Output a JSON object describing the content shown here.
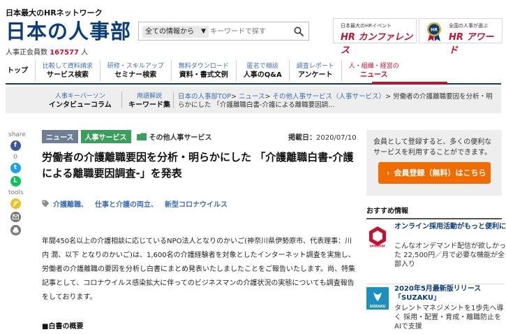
{
  "header": {
    "tagline": "日本最大のHRネットワーク",
    "logo": "日本の人事部",
    "member_label": "人事正会員数",
    "member_count": "167577",
    "member_unit": "人"
  },
  "search": {
    "scope": "全ての情報から",
    "placeholder": "キーワードで探す"
  },
  "banners": {
    "conference_small": "日本最大のHRイベント",
    "conference_big": "HR カンファレンス",
    "award_small": "全国の人事が選ぶ",
    "award_big": "HR アワード"
  },
  "nav": [
    {
      "top": "",
      "bottom": "トップ"
    },
    {
      "top": "比較して資料請求",
      "bottom": "サービス検索"
    },
    {
      "top": "研修・スキルアップ",
      "bottom": "セミナー検索"
    },
    {
      "top": "無料ダウンロード",
      "bottom": "資料・書式文例"
    },
    {
      "top": "匿名で相談",
      "bottom": "人事のQ&A"
    },
    {
      "top": "調査レポート",
      "bottom": "アンケート"
    },
    {
      "top": "人・組織・経営の",
      "bottom": "ニュース"
    }
  ],
  "subnav": {
    "interview_top": "人事キーパーソン",
    "interview_bottom": "インタビューコラム",
    "keyword_top": "用語解説",
    "keyword_bottom": "キーワード集"
  },
  "breadcrumb": {
    "home": "日本の人事部TOP",
    "news": "ニュース",
    "category": "その他人事サービス（人事サービス）",
    "current": "労働者の介護離職要因を分析・明らかにした 「介護離職白書-介護による離職要因調..."
  },
  "rail": {
    "share_label": "share",
    "share_count": "0",
    "tools_label": "tools",
    "facebook_glyph": "f",
    "twitter_glyph": "t",
    "line_glyph": "L"
  },
  "article": {
    "tag_news": "ニュース",
    "tag_service": "人事サービス",
    "folder_label": "その他人事サービス",
    "date_label": "掲載日：",
    "date": "2020/07/10",
    "title": "労働者の介護離職要因を分析・明らかにした 「介護離職白書-介護による離職要因調査-」を発表",
    "keywords": [
      "介護離職、",
      "仕事と介護の両立、",
      "新型コロナウイルス"
    ],
    "body": "年間450名以上の介護相談に応じているNPO法人となりのかいご(神奈川県伊勢原市、代表理事：川内 潤、以下 となりのかいご)は、1,600名の介護経験者を対象としたインターネット調査を実施し、労働者の介護離職の要因を分析し白書にまとめ発表いたしましたことをご報告いたします。尚、特集記事として、コロナウイルス感染拡大に伴ってのビジネスマンの介護状況の実態についても調査報告をしております。",
    "section_heading": "■白書の概要"
  },
  "sidebar": {
    "info_text": "会員として登録すると、多くの便利なサービスを利用することができます。",
    "register_label": "会員登録（無料）はこちら",
    "recommend_heading": "おすすめ情報",
    "items": [
      {
        "title": "オンライン採用活動がもっと便利に",
        "desc": "こんなオンデマンド配信が欲しかった 22,500円／月で必要な機能が全部入り",
        "thumb_label": "seminar"
      },
      {
        "title": "2020年5月最新版リリース「SUZAKU」",
        "desc": "タレントマネジメントを1歩先へ導く 採用・配置・育成・離職防止をAIで支援",
        "thumb_label": "SUZAKU"
      }
    ]
  },
  "colors": {
    "brand_navy": "#0b3d7a",
    "accent_red": "#c8102e",
    "cta_orange": "#f06b00",
    "link_blue": "#3a6fb5",
    "tag_news": "#6e7f95",
    "tag_service": "#3a9f5a"
  }
}
